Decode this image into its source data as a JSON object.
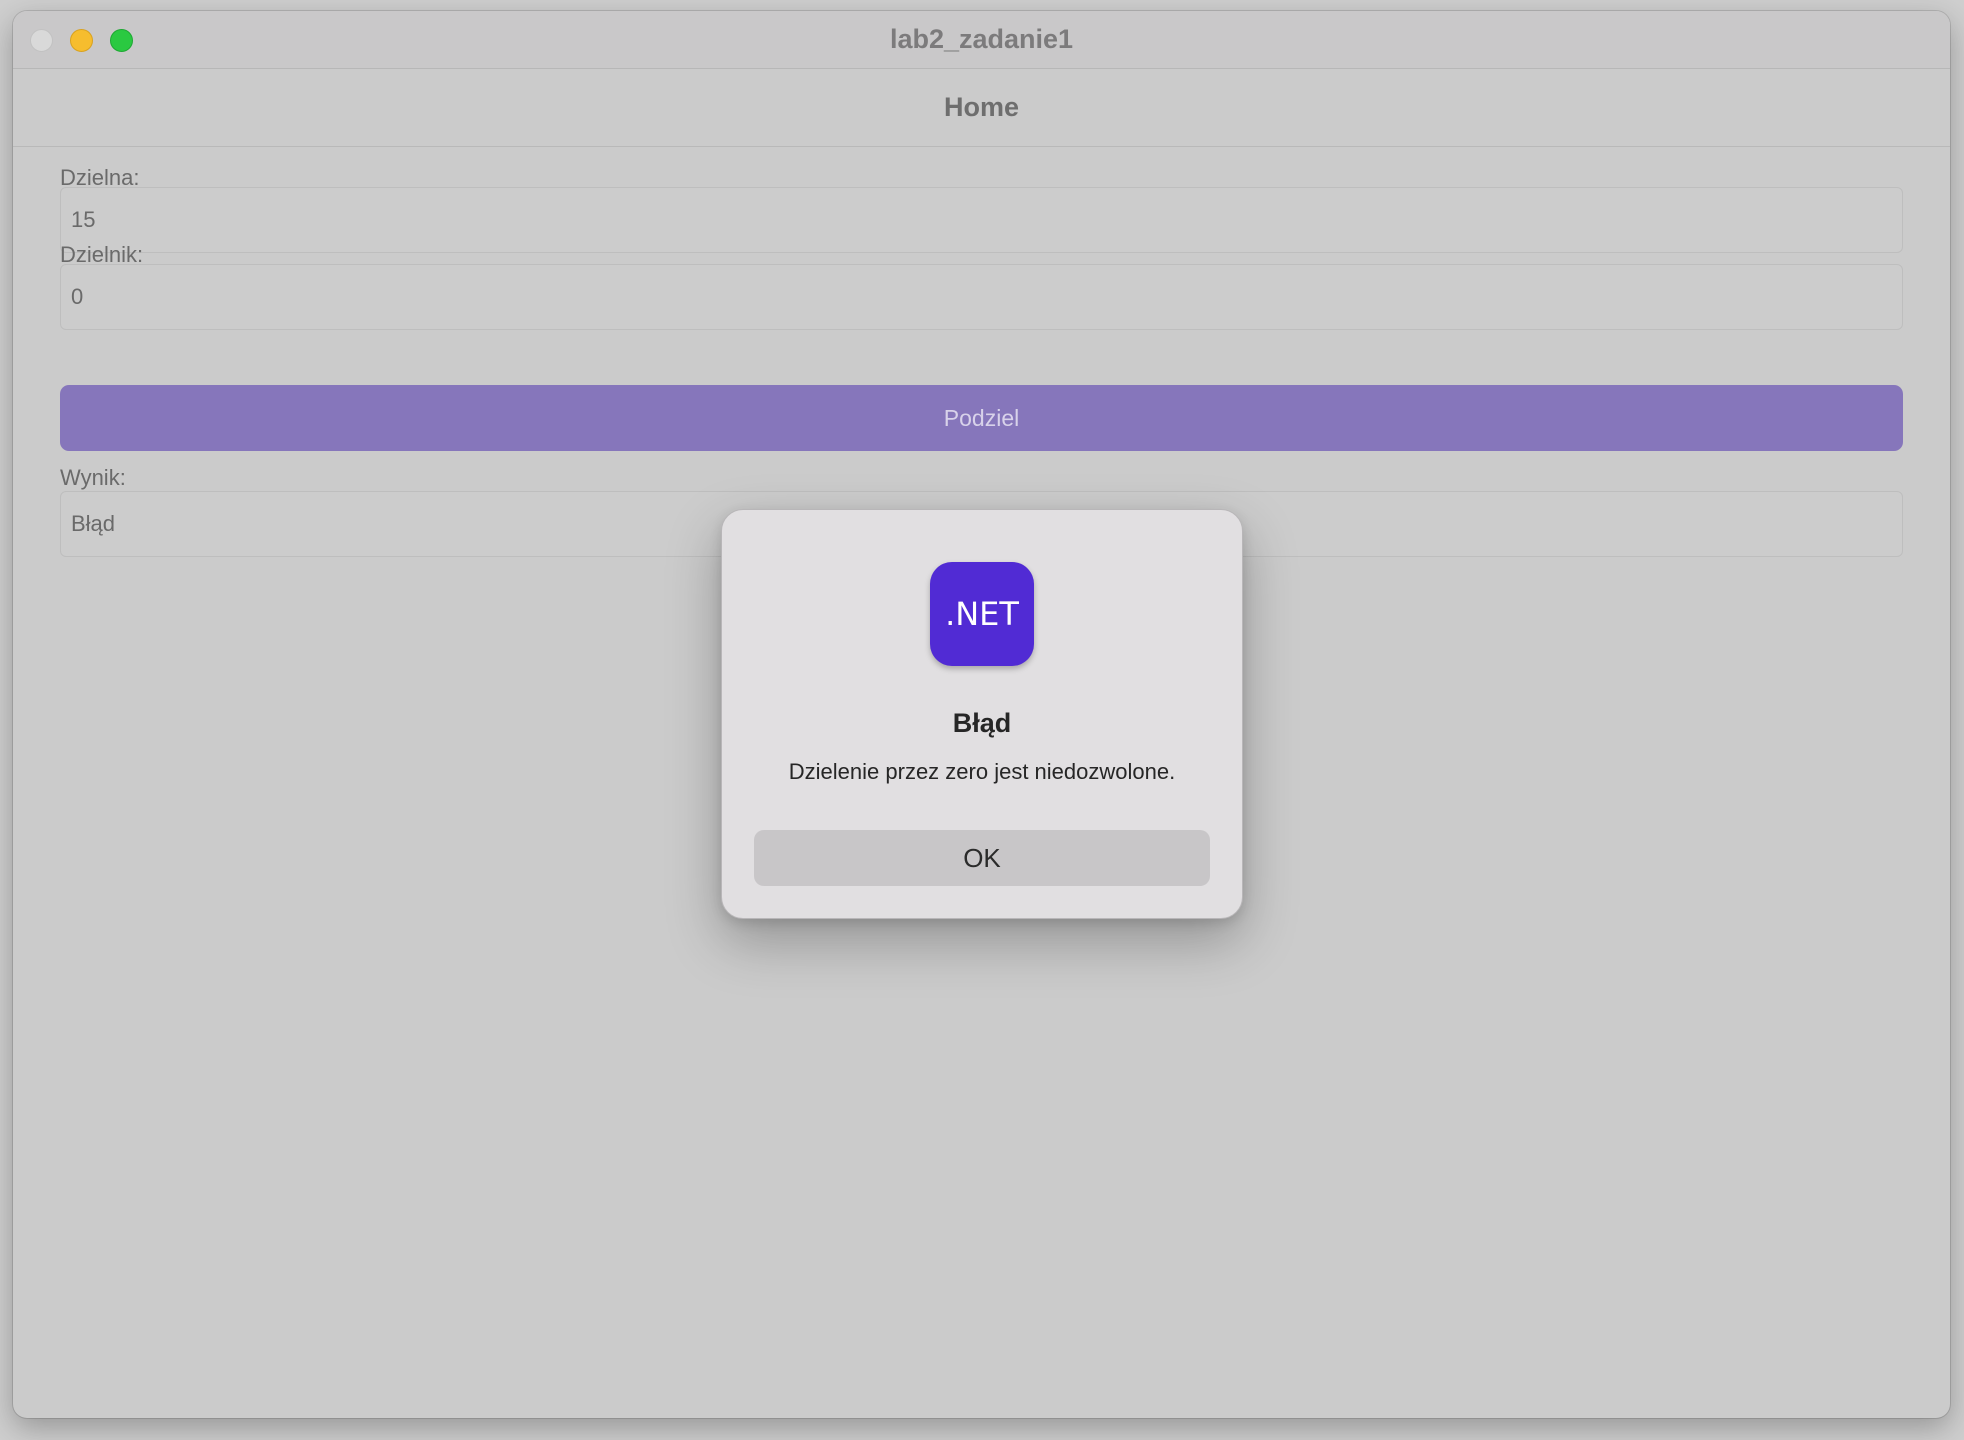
{
  "window": {
    "title": "lab2_zadanie1"
  },
  "navbar": {
    "title": "Home"
  },
  "form": {
    "dividend_label": "Dzielna:",
    "dividend_value": "15",
    "divisor_label": "Dzielnik:",
    "divisor_value": "0",
    "divide_button": "Podziel",
    "result_label": "Wynik:",
    "result_value": "Błąd"
  },
  "alert": {
    "icon_text": ".NET",
    "title": "Błąd",
    "message": "Dzielenie przez zero jest niedozwolone.",
    "ok_button": "OK"
  },
  "colors": {
    "accent_button": "#8676bb",
    "app_icon": "#512bd4",
    "traffic_close": "#d9d9d9",
    "traffic_minimize": "#f6bd2e",
    "traffic_maximize": "#2ac941"
  },
  "icons": {
    "close": "close-window-icon",
    "minimize": "minimize-window-icon",
    "maximize": "maximize-window-icon",
    "app": "dotnet-app-icon"
  }
}
